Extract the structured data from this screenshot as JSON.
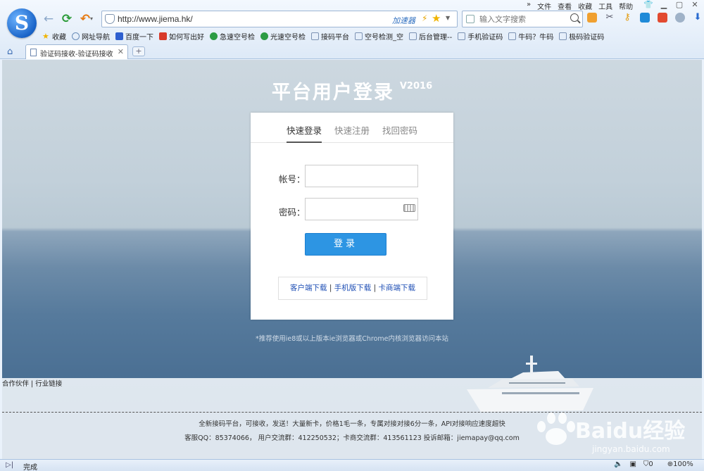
{
  "browser": {
    "menu": [
      "»",
      "文件",
      "查看",
      "收藏",
      "工具",
      "帮助"
    ],
    "address": {
      "url": "http://www.jiema.hk/",
      "accelerator_label": "加速器"
    },
    "search": {
      "placeholder": "输入文字搜索"
    },
    "bookmarks": [
      {
        "label": "收藏",
        "icon": "star-icon",
        "color": "#f0b400"
      },
      {
        "label": "网址导航",
        "icon": "globe-icon",
        "color": "#6a8db8"
      },
      {
        "label": "百度一下",
        "icon": "baidu-paw-icon",
        "color": "#2e5fcf"
      },
      {
        "label": "如何写出好",
        "icon": "windmill-icon",
        "color": "#d83a2a"
      },
      {
        "label": "急速空号检",
        "icon": "swirl-icon",
        "color": "#2c9c44"
      },
      {
        "label": "光速空号检",
        "icon": "swirl-icon",
        "color": "#2c9c44"
      },
      {
        "label": "接码平台",
        "icon": "page-icon",
        "color": "#7d93b4"
      },
      {
        "label": "空号检测_空",
        "icon": "page-icon",
        "color": "#7d93b4"
      },
      {
        "label": "后台管理--",
        "icon": "page-icon",
        "color": "#7d93b4"
      },
      {
        "label": "手机验证码",
        "icon": "page-icon",
        "color": "#7d93b4"
      },
      {
        "label": "牛码？牛码",
        "icon": "page-icon",
        "color": "#7d93b4"
      },
      {
        "label": "极码验证码",
        "icon": "page-icon",
        "color": "#7d93b4"
      }
    ],
    "tab": {
      "title": "验证码接收-验证码接收"
    },
    "status": {
      "text": "完成",
      "count": "0",
      "zoom": "100%"
    }
  },
  "page": {
    "title": "平台用户登录",
    "version": "V2016",
    "tabs": [
      {
        "label": "快速登录",
        "active": true
      },
      {
        "label": "快速注册",
        "active": false
      },
      {
        "label": "找回密码",
        "active": false
      }
    ],
    "account_label": "帐号：",
    "password_label": "密码：",
    "login_button": "登录",
    "downloads": {
      "client": "客户端下载",
      "mobile": "手机版下载",
      "card": "卡商端下载",
      "sep": " | "
    },
    "recommend": "*推荐使用ie8或以上版本ie浏览器或Chrome内核浏览器访问本站",
    "partners": "合作伙伴 | 行业链接",
    "footer_line1": "全新接码平台，可接收，发送！大量新卡，价格1毛一条，专属对接对接6分一条，API对接响应速度超快",
    "footer_line2": "客服QQ：85374066， 用户交流群：412250532；卡商交流群：413561123 投诉邮箱：jiemapay@qq.com"
  },
  "watermark": {
    "brand": "Baidu经验",
    "url": "jingyan.baidu.com"
  }
}
